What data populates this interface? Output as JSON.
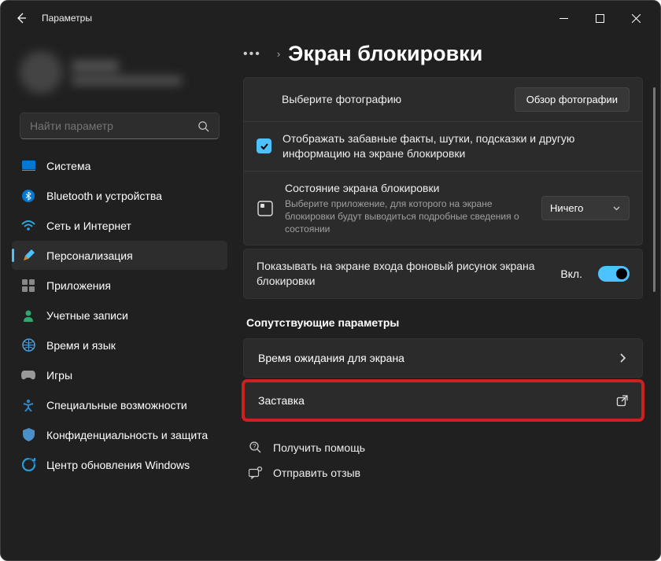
{
  "window": {
    "title": "Параметры"
  },
  "search": {
    "placeholder": "Найти параметр"
  },
  "nav": {
    "items": [
      {
        "label": "Система"
      },
      {
        "label": "Bluetooth и устройства"
      },
      {
        "label": "Сеть и Интернет"
      },
      {
        "label": "Персонализация"
      },
      {
        "label": "Приложения"
      },
      {
        "label": "Учетные записи"
      },
      {
        "label": "Время и язык"
      },
      {
        "label": "Игры"
      },
      {
        "label": "Специальные возможности"
      },
      {
        "label": "Конфиденциальность и защита"
      },
      {
        "label": "Центр обновления Windows"
      }
    ]
  },
  "page": {
    "title": "Экран блокировки"
  },
  "photo": {
    "choose_label": "Выберите фотографию",
    "browse_label": "Обзор фотографии"
  },
  "funfacts": {
    "label": "Отображать забавные факты, шутки, подсказки и другую информацию на экране блокировки"
  },
  "status": {
    "title": "Состояние экрана блокировки",
    "sub": "Выберите приложение, для которого на экране блокировки будут выводиться подробные сведения о состоянии",
    "value": "Ничего"
  },
  "signin_bg": {
    "label": "Показывать на экране входа фоновый рисунок экрана блокировки",
    "toggle_text": "Вкл."
  },
  "related": {
    "title": "Сопутствующие параметры",
    "timeout_label": "Время ожидания для экрана",
    "screensaver_label": "Заставка"
  },
  "footer": {
    "help": "Получить помощь",
    "feedback": "Отправить отзыв"
  }
}
